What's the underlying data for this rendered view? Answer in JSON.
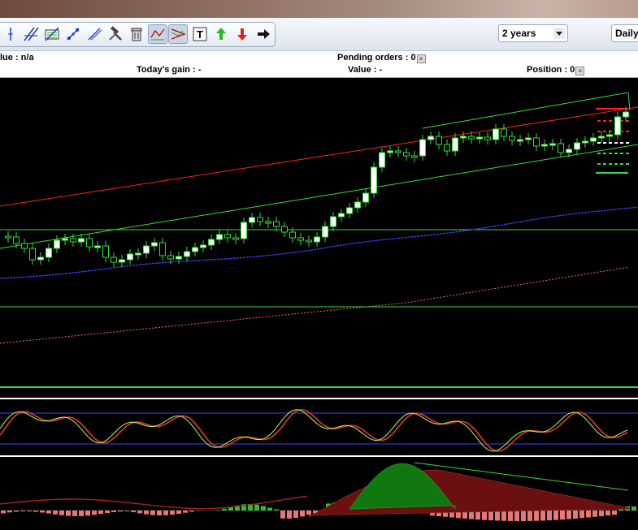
{
  "toolbar": {
    "tools": [
      {
        "name": "vertical-line-tool",
        "active": false
      },
      {
        "name": "parallel-lines-tool",
        "active": false
      },
      {
        "name": "fibonacci-tool",
        "active": false
      },
      {
        "name": "trend-line-tool",
        "active": false
      },
      {
        "name": "ray-line-tool",
        "active": false
      },
      {
        "name": "hammer-tool",
        "active": false
      },
      {
        "name": "trash-tool",
        "active": false
      },
      {
        "name": "channel-tool",
        "active": true
      },
      {
        "name": "triangle-tool",
        "active": true
      },
      {
        "name": "text-tool",
        "active": false
      },
      {
        "name": "buy-arrow-tool",
        "active": false
      },
      {
        "name": "sell-arrow-tool",
        "active": false
      },
      {
        "name": "next-arrow-tool",
        "active": false
      }
    ],
    "period_select": "2 years",
    "interval_select": "Daily"
  },
  "info": {
    "value_text": "lue : n/a",
    "pending_orders": "Pending orders : 0",
    "todays_gain": "Today's gain : -",
    "value_dash": "Value : -",
    "position": "Position : 0"
  },
  "colors": {
    "price_up": "#ffffff",
    "price_down": "#ffffff",
    "candle_border": "#33dd33",
    "channel_red": "#ff2020",
    "channel_green": "#33dd33",
    "ma_blue": "#3344ff",
    "ma_salmon": "#e87070",
    "macd_pos": "#33bb33",
    "macd_neg": "#e87878"
  }
}
